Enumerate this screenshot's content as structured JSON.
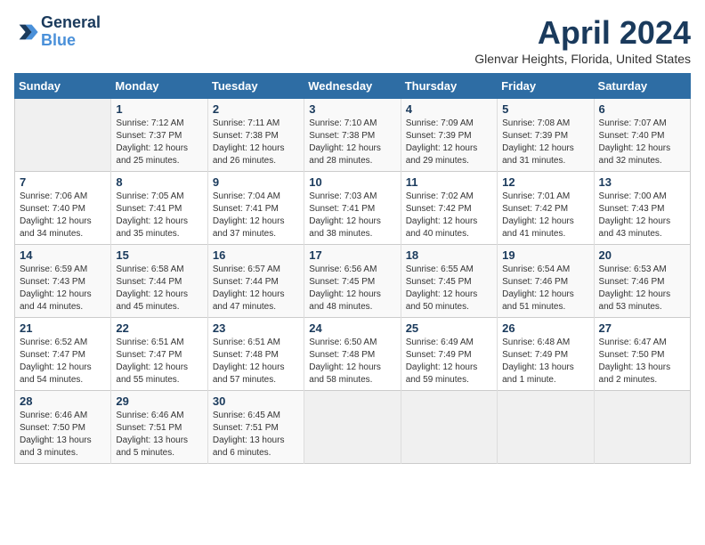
{
  "header": {
    "logo_line1": "General",
    "logo_line2": "Blue",
    "month_year": "April 2024",
    "location": "Glenvar Heights, Florida, United States"
  },
  "weekdays": [
    "Sunday",
    "Monday",
    "Tuesday",
    "Wednesday",
    "Thursday",
    "Friday",
    "Saturday"
  ],
  "weeks": [
    [
      {
        "day": "",
        "empty": true
      },
      {
        "day": "1",
        "sunrise": "7:12 AM",
        "sunset": "7:37 PM",
        "daylight": "12 hours and 25 minutes."
      },
      {
        "day": "2",
        "sunrise": "7:11 AM",
        "sunset": "7:38 PM",
        "daylight": "12 hours and 26 minutes."
      },
      {
        "day": "3",
        "sunrise": "7:10 AM",
        "sunset": "7:38 PM",
        "daylight": "12 hours and 28 minutes."
      },
      {
        "day": "4",
        "sunrise": "7:09 AM",
        "sunset": "7:39 PM",
        "daylight": "12 hours and 29 minutes."
      },
      {
        "day": "5",
        "sunrise": "7:08 AM",
        "sunset": "7:39 PM",
        "daylight": "12 hours and 31 minutes."
      },
      {
        "day": "6",
        "sunrise": "7:07 AM",
        "sunset": "7:40 PM",
        "daylight": "12 hours and 32 minutes."
      }
    ],
    [
      {
        "day": "7",
        "sunrise": "7:06 AM",
        "sunset": "7:40 PM",
        "daylight": "12 hours and 34 minutes."
      },
      {
        "day": "8",
        "sunrise": "7:05 AM",
        "sunset": "7:41 PM",
        "daylight": "12 hours and 35 minutes."
      },
      {
        "day": "9",
        "sunrise": "7:04 AM",
        "sunset": "7:41 PM",
        "daylight": "12 hours and 37 minutes."
      },
      {
        "day": "10",
        "sunrise": "7:03 AM",
        "sunset": "7:41 PM",
        "daylight": "12 hours and 38 minutes."
      },
      {
        "day": "11",
        "sunrise": "7:02 AM",
        "sunset": "7:42 PM",
        "daylight": "12 hours and 40 minutes."
      },
      {
        "day": "12",
        "sunrise": "7:01 AM",
        "sunset": "7:42 PM",
        "daylight": "12 hours and 41 minutes."
      },
      {
        "day": "13",
        "sunrise": "7:00 AM",
        "sunset": "7:43 PM",
        "daylight": "12 hours and 43 minutes."
      }
    ],
    [
      {
        "day": "14",
        "sunrise": "6:59 AM",
        "sunset": "7:43 PM",
        "daylight": "12 hours and 44 minutes."
      },
      {
        "day": "15",
        "sunrise": "6:58 AM",
        "sunset": "7:44 PM",
        "daylight": "12 hours and 45 minutes."
      },
      {
        "day": "16",
        "sunrise": "6:57 AM",
        "sunset": "7:44 PM",
        "daylight": "12 hours and 47 minutes."
      },
      {
        "day": "17",
        "sunrise": "6:56 AM",
        "sunset": "7:45 PM",
        "daylight": "12 hours and 48 minutes."
      },
      {
        "day": "18",
        "sunrise": "6:55 AM",
        "sunset": "7:45 PM",
        "daylight": "12 hours and 50 minutes."
      },
      {
        "day": "19",
        "sunrise": "6:54 AM",
        "sunset": "7:46 PM",
        "daylight": "12 hours and 51 minutes."
      },
      {
        "day": "20",
        "sunrise": "6:53 AM",
        "sunset": "7:46 PM",
        "daylight": "12 hours and 53 minutes."
      }
    ],
    [
      {
        "day": "21",
        "sunrise": "6:52 AM",
        "sunset": "7:47 PM",
        "daylight": "12 hours and 54 minutes."
      },
      {
        "day": "22",
        "sunrise": "6:51 AM",
        "sunset": "7:47 PM",
        "daylight": "12 hours and 55 minutes."
      },
      {
        "day": "23",
        "sunrise": "6:51 AM",
        "sunset": "7:48 PM",
        "daylight": "12 hours and 57 minutes."
      },
      {
        "day": "24",
        "sunrise": "6:50 AM",
        "sunset": "7:48 PM",
        "daylight": "12 hours and 58 minutes."
      },
      {
        "day": "25",
        "sunrise": "6:49 AM",
        "sunset": "7:49 PM",
        "daylight": "12 hours and 59 minutes."
      },
      {
        "day": "26",
        "sunrise": "6:48 AM",
        "sunset": "7:49 PM",
        "daylight": "13 hours and 1 minute."
      },
      {
        "day": "27",
        "sunrise": "6:47 AM",
        "sunset": "7:50 PM",
        "daylight": "13 hours and 2 minutes."
      }
    ],
    [
      {
        "day": "28",
        "sunrise": "6:46 AM",
        "sunset": "7:50 PM",
        "daylight": "13 hours and 3 minutes."
      },
      {
        "day": "29",
        "sunrise": "6:46 AM",
        "sunset": "7:51 PM",
        "daylight": "13 hours and 5 minutes."
      },
      {
        "day": "30",
        "sunrise": "6:45 AM",
        "sunset": "7:51 PM",
        "daylight": "13 hours and 6 minutes."
      },
      {
        "day": "",
        "empty": true
      },
      {
        "day": "",
        "empty": true
      },
      {
        "day": "",
        "empty": true
      },
      {
        "day": "",
        "empty": true
      }
    ]
  ]
}
